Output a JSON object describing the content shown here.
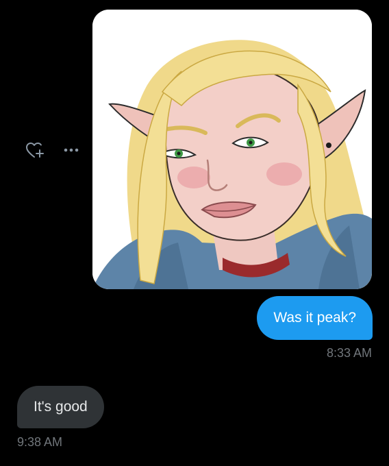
{
  "colors": {
    "background": "#000000",
    "sent_bubble": "#1d9bf0",
    "received_bubble": "#2f3336",
    "timestamp": "#71767b"
  },
  "actions": {
    "react_icon": "heart-plus-icon",
    "more_icon": "more-horizontal-icon"
  },
  "messages": {
    "image": {
      "alt": "Illustration of a smug blonde elf with green eyes and a red choker"
    },
    "sent": {
      "text": "Was it peak?",
      "time": "8:33 AM"
    },
    "received": {
      "text": "It's good",
      "time": "9:38 AM"
    }
  }
}
